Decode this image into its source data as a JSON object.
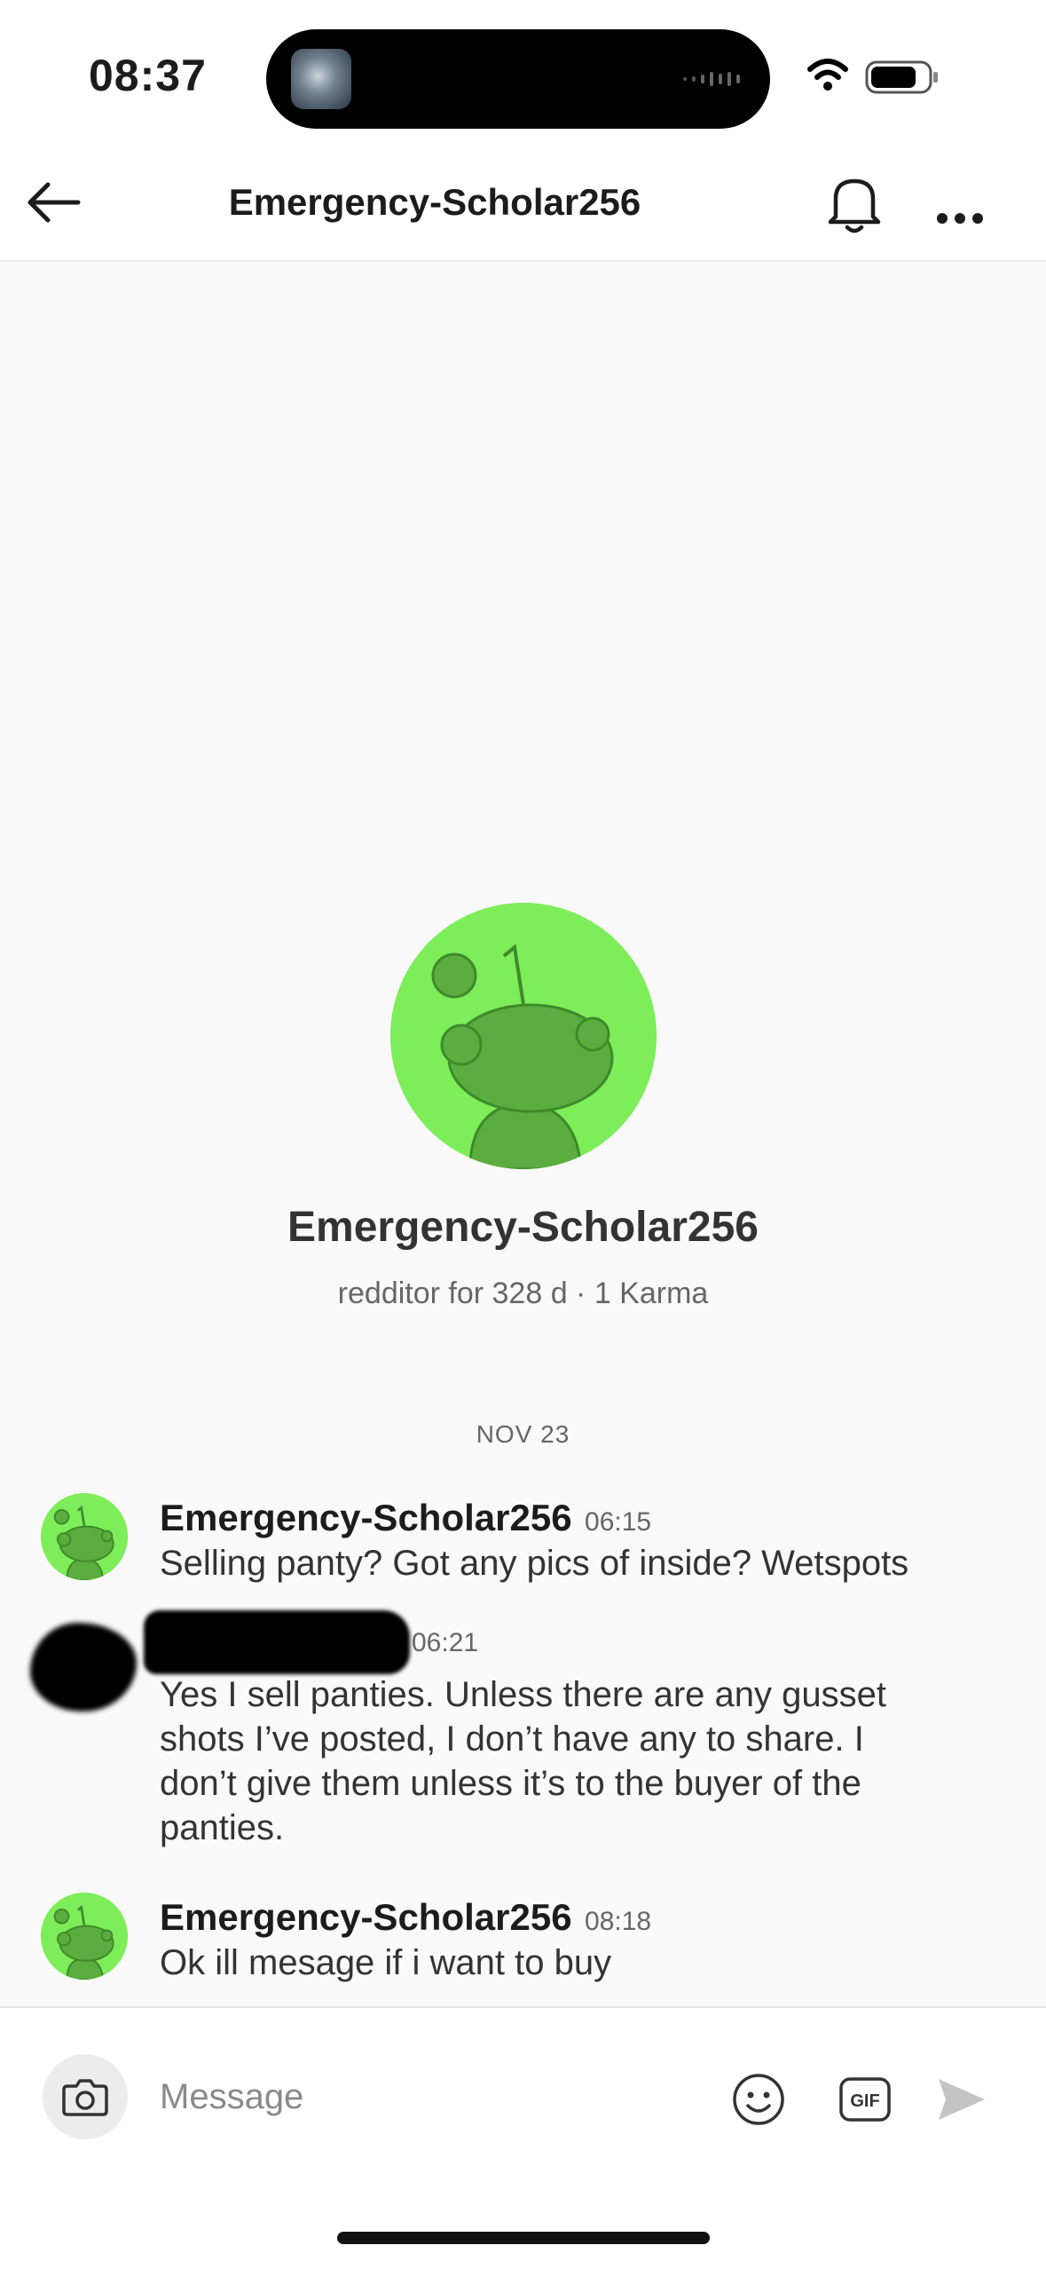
{
  "status_bar": {
    "time": "08:37"
  },
  "header": {
    "title": "Emergency-Scholar256"
  },
  "profile": {
    "name": "Emergency-Scholar256",
    "meta": "redditor for 328 d · 1 Karma"
  },
  "conversation": {
    "date_separator": "NOV 23",
    "messages": [
      {
        "author": "Emergency-Scholar256",
        "time": "06:15",
        "text": "Selling panty? Got any pics of inside? Wetspots"
      },
      {
        "author": "",
        "time": "06:21",
        "lines": [
          "Yes I sell panties. Unless there are any gusset",
          "shots I’ve posted, I don’t have any to share. I",
          "don’t give them unless it’s to the buyer of the",
          "panties."
        ]
      },
      {
        "author": "Emergency-Scholar256",
        "time": "08:18",
        "text": "Ok ill mesage if i want to buy"
      }
    ]
  },
  "composer": {
    "placeholder": "Message",
    "gif_label": "GIF"
  },
  "colors": {
    "avatar_green": "#7ded5a",
    "snoo_green": "#5aad3e",
    "background": "#f9f9f9"
  },
  "icons": {
    "back": "arrow-left-icon",
    "bell": "bell-icon",
    "more": "more-horizontal-icon",
    "camera": "camera-icon",
    "emoji": "emoji-icon",
    "gif": "gif-icon",
    "send": "send-icon"
  }
}
